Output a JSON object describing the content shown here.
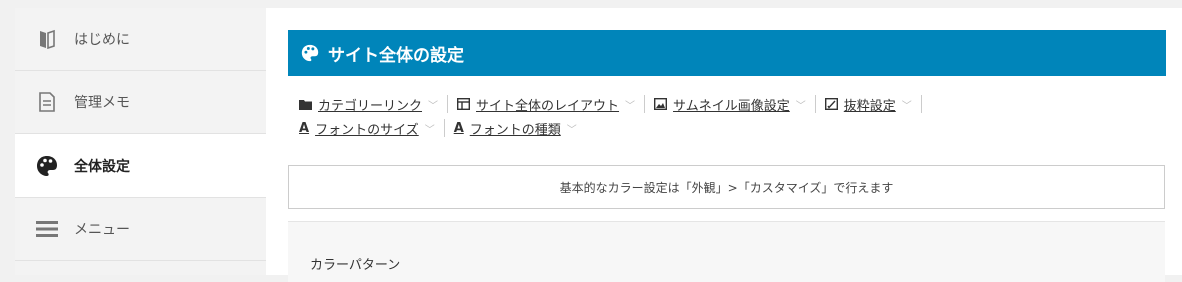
{
  "sidebar": {
    "items": [
      {
        "label": "はじめに",
        "icon": "bookmark-icon"
      },
      {
        "label": "管理メモ",
        "icon": "document-icon"
      },
      {
        "label": "全体設定",
        "icon": "palette-icon",
        "active": true
      },
      {
        "label": "メニュー",
        "icon": "menu-icon"
      }
    ]
  },
  "main": {
    "title": "サイト全体の設定",
    "links": [
      {
        "label": "カテゴリーリンク",
        "icon": "folder-icon"
      },
      {
        "label": "サイト全体のレイアウト",
        "icon": "layout-icon"
      },
      {
        "label": "サムネイル画像設定",
        "icon": "image-icon"
      },
      {
        "label": "抜粋設定",
        "icon": "edit-icon"
      },
      {
        "label": "フォントのサイズ",
        "icon": "font-icon",
        "glyph": "A"
      },
      {
        "label": "フォントの種類",
        "icon": "font-icon",
        "glyph": "A"
      }
    ],
    "notice": "基本的なカラー設定は「外観」>「カスタマイズ」で行えます",
    "section_title": "カラーパターン"
  },
  "colors": {
    "accent": "#0085ba"
  }
}
